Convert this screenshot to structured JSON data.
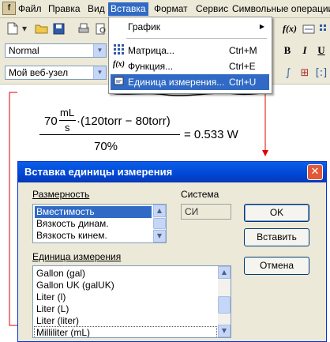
{
  "menubar": {
    "items": [
      "Файл",
      "Правка",
      "Вид",
      "Вставка",
      "Формат",
      "Сервис",
      "Символьные операции"
    ]
  },
  "toolbar": {
    "style_combo": "Normal",
    "web_combo": "Мой веб-узел",
    "bold": "B",
    "italic": "I",
    "underline": "U"
  },
  "insert_menu": {
    "items": [
      {
        "label": "График",
        "shortcut": "",
        "icon": "graph",
        "submenu": true
      },
      {
        "label": "Матрица...",
        "shortcut": "Ctrl+M",
        "icon": "matrix-icon"
      },
      {
        "label": "Функция...",
        "shortcut": "Ctrl+E",
        "icon": "function-icon"
      },
      {
        "label": "Единица измерения...",
        "shortcut": "Ctrl+U",
        "icon": "unit-icon",
        "highlighted": true
      }
    ]
  },
  "worksheet": {
    "equation": {
      "coef": "70",
      "unit_num": "mL",
      "unit_den": "s",
      "expression": "·(120torr − 80torr)",
      "denominator": "70%",
      "result": "= 0.533 W"
    }
  },
  "dialog": {
    "title": "Вставка единицы измерения",
    "dimension_label": "Размерность",
    "dimension_items": [
      {
        "text": "Вместимость",
        "selected": true
      },
      {
        "text": "Вязкость динам.",
        "selected": false
      },
      {
        "text": "Вязкость кинем.",
        "selected": false
      }
    ],
    "system_label": "Система",
    "system_value": "СИ",
    "unit_label": "Единица измерения",
    "unit_items": [
      {
        "text": "Gallon (gal)",
        "selected": false
      },
      {
        "text": "Gallon UK (galUK)",
        "selected": false
      },
      {
        "text": "Liter (l)",
        "selected": false
      },
      {
        "text": "Liter (L)",
        "selected": false
      },
      {
        "text": "Liter (liter)",
        "selected": false
      },
      {
        "text": "Milliliter (mL)",
        "selected": true
      }
    ],
    "buttons": {
      "ok": "OK",
      "insert": "Вставить",
      "cancel": "Отмена"
    },
    "close": "✕"
  },
  "colors": {
    "highlight": "#316ac5",
    "titlebar": "#0046d5",
    "annotation": "#e00000"
  }
}
